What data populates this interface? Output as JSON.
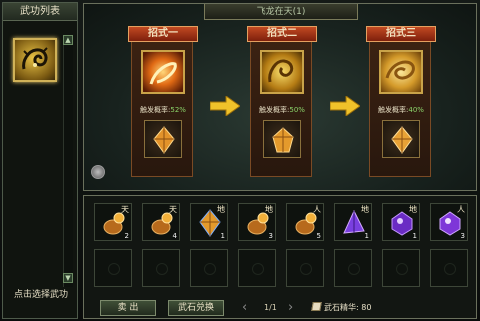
{
  "left_panel": {
    "title": "武功列表",
    "footer": "点击选择武功",
    "selected_skill_icon": "golden-dragon-icon"
  },
  "top_panel": {
    "title": "飞龙在天(1)",
    "moves": [
      {
        "label": "招式一",
        "rate_label": "触发概率:",
        "rate": "52%",
        "icon": "fire-swirl-icon"
      },
      {
        "label": "招式二",
        "rate_label": "触发概率:",
        "rate": "50%",
        "icon": "golden-dragon-icon"
      },
      {
        "label": "招式三",
        "rate_label": "触发概率:",
        "rate": "40%",
        "icon": "golden-dragon-swirl-icon"
      }
    ],
    "colors": {
      "rate": "#8bd46a",
      "move_head": "#c24a22"
    }
  },
  "inventory": {
    "items": [
      {
        "tag": "天",
        "qty": "2",
        "icon": "orange-gem-pouch-icon"
      },
      {
        "tag": "天",
        "qty": "4",
        "icon": "orange-gem-pouch-icon"
      },
      {
        "tag": "地",
        "qty": "1",
        "icon": "orange-crystal-icon"
      },
      {
        "tag": "地",
        "qty": "3",
        "icon": "orange-gem-pouch-icon"
      },
      {
        "tag": "人",
        "qty": "5",
        "icon": "orange-gem-pouch-icon"
      },
      {
        "tag": "地",
        "qty": "1",
        "icon": "purple-crystal-icon"
      },
      {
        "tag": "地",
        "qty": "1",
        "icon": "purple-gem-icon"
      },
      {
        "tag": "人",
        "qty": "3",
        "icon": "purple-gem-icon"
      }
    ],
    "sell_label": "卖 出",
    "exchange_label": "武石兑换",
    "page": "1/1",
    "essence_label": "武石精华: 80"
  }
}
